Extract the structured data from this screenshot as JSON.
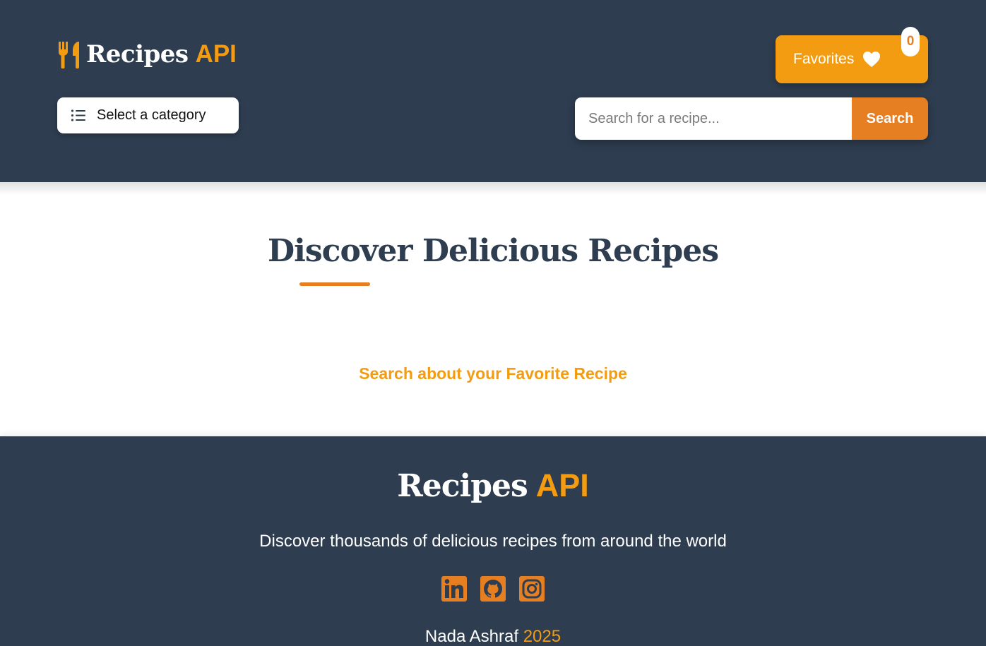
{
  "colors": {
    "header_bg": "#2e3d50",
    "accent_yellow": "#f39c12",
    "accent_orange": "#e67e22",
    "text_white": "#ffffff"
  },
  "header": {
    "logo_icon": "utensils-icon",
    "logo_text": "Recipes",
    "logo_accent": "API",
    "favorites": {
      "label": "Favorites",
      "icon": "heart-icon",
      "count": "0"
    },
    "category": {
      "icon": "list-icon",
      "label": "Select a category"
    },
    "search": {
      "placeholder": "Search for a recipe...",
      "value": "",
      "button_label": "Search"
    }
  },
  "main": {
    "title": "Discover Delicious Recipes",
    "hint": "Search about your Favorite Recipe"
  },
  "footer": {
    "brand": "Recipes",
    "brand_accent": "API",
    "tagline": "Discover thousands of delicious recipes from around the world",
    "socials": [
      {
        "icon": "linkedin-icon"
      },
      {
        "icon": "github-icon"
      },
      {
        "icon": "instagram-icon"
      }
    ],
    "author": "Nada Ashraf",
    "year": "2025"
  }
}
